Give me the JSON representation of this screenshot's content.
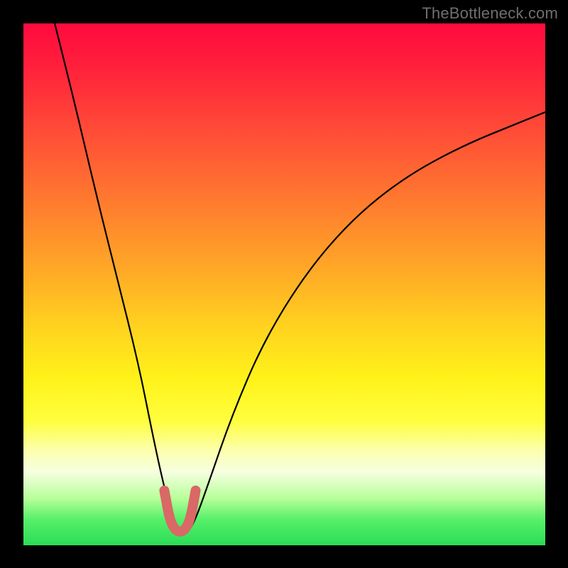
{
  "watermark": "TheBottleneck.com",
  "chart_data": {
    "type": "line",
    "title": "",
    "xlabel": "",
    "ylabel": "",
    "xlim": [
      0,
      100
    ],
    "ylim": [
      0,
      100
    ],
    "series": [
      {
        "name": "bottleneck-curve",
        "x": [
          6,
          10,
          14,
          18,
          22,
          25,
          27,
          28.5,
          30,
          31.5,
          33,
          35.5,
          40,
          46,
          54,
          63,
          73,
          84,
          95,
          100
        ],
        "values": [
          100,
          84,
          67,
          51,
          35,
          20,
          11,
          5.5,
          2.5,
          2.4,
          5,
          12,
          25,
          39,
          52,
          62.5,
          70.5,
          76.5,
          81,
          83
        ]
      },
      {
        "name": "optimal-zone",
        "x": [
          27,
          28,
          29,
          30,
          31,
          32,
          33
        ],
        "values": [
          10.5,
          5.0,
          3.0,
          2.5,
          3.0,
          5.0,
          10.5
        ]
      }
    ],
    "gradient_stops": [
      {
        "pos": 0,
        "color": "#ff0a3e"
      },
      {
        "pos": 34,
        "color": "#ff7a2f"
      },
      {
        "pos": 68,
        "color": "#fff21a"
      },
      {
        "pos": 86,
        "color": "#f5ffe0"
      },
      {
        "pos": 100,
        "color": "#2bdc57"
      }
    ],
    "colors": {
      "curve": "#000000",
      "optimal_zone": "#d96866",
      "frame": "#000000"
    }
  }
}
